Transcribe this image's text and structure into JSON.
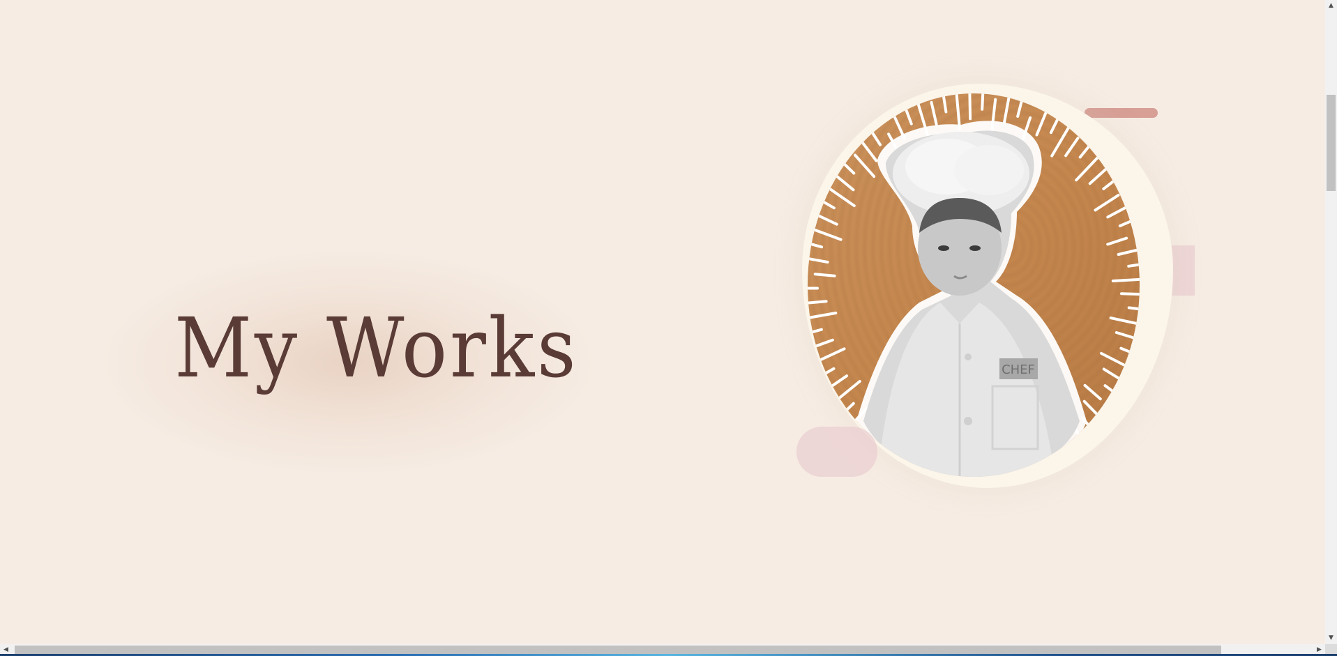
{
  "hero": {
    "title": "My Works"
  },
  "portrait": {
    "badge_text": "CHEF"
  },
  "colors": {
    "background": "#f6ece3",
    "title": "#5a3b36",
    "accent_pink": "#d79f96",
    "wood": "#c7894f"
  },
  "scrollbars": {
    "up_arrow": "▲",
    "down_arrow": "▼",
    "left_arrow": "◀",
    "right_arrow": "▶"
  }
}
